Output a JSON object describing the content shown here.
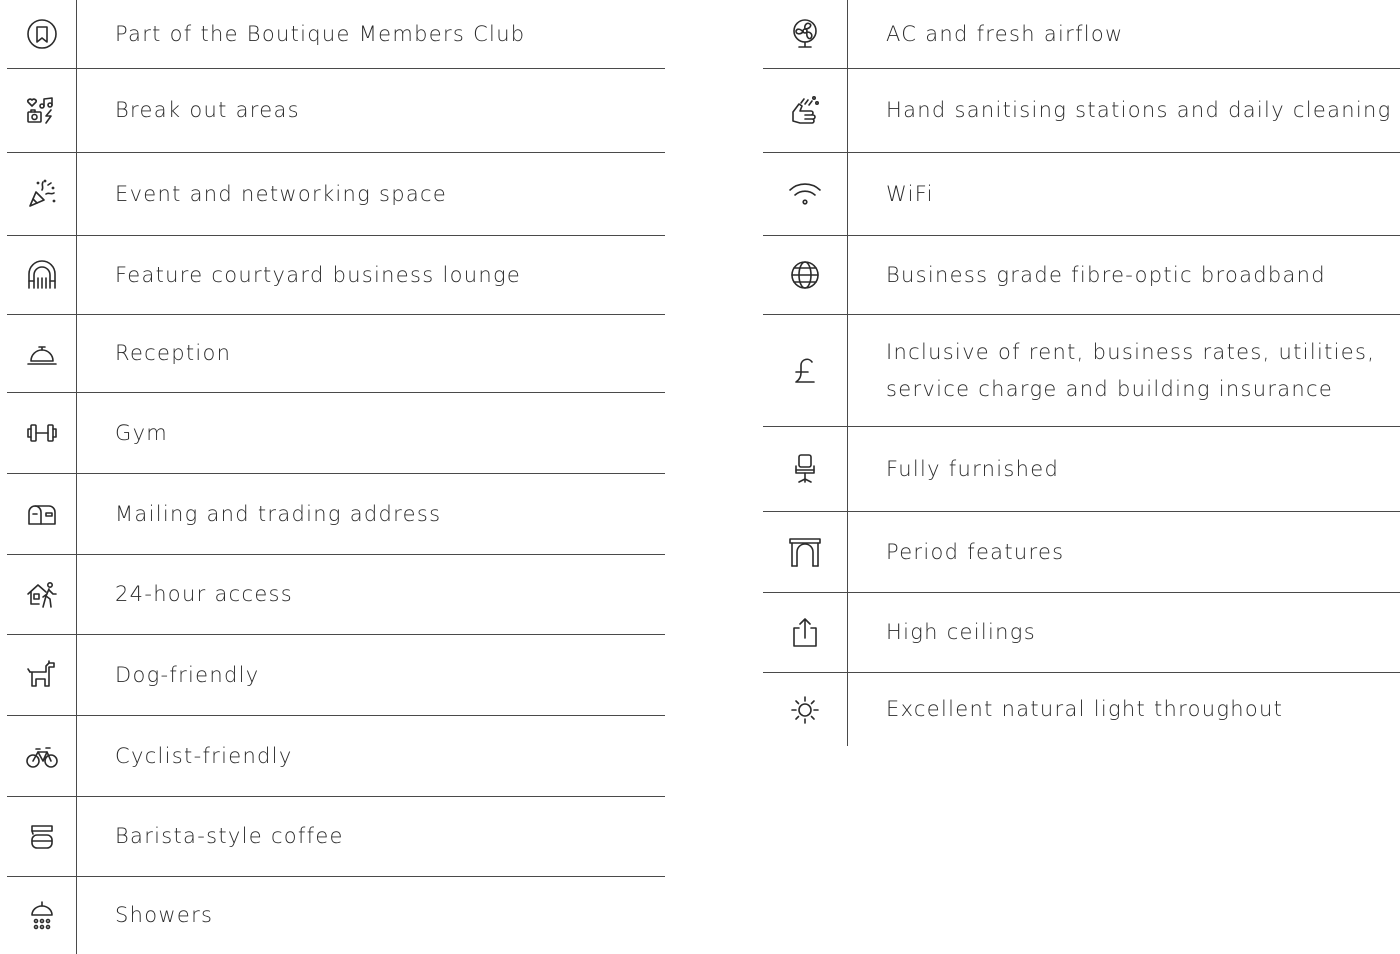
{
  "left_features": [
    {
      "icon": "members-club-icon",
      "label": "Part of the Boutique Members Club"
    },
    {
      "icon": "breakout-areas-icon",
      "label": "Break out areas"
    },
    {
      "icon": "party-popper-icon",
      "label": "Event and networking space"
    },
    {
      "icon": "courtyard-arch-icon",
      "label": "Feature courtyard business lounge"
    },
    {
      "icon": "reception-bell-icon",
      "label": "Reception"
    },
    {
      "icon": "dumbbell-icon",
      "label": "Gym"
    },
    {
      "icon": "mailbox-icon",
      "label": "Mailing and trading address"
    },
    {
      "icon": "house-walking-person-icon",
      "label": "24-hour access"
    },
    {
      "icon": "dog-icon",
      "label": "Dog-friendly"
    },
    {
      "icon": "bicycle-icon",
      "label": "Cyclist-friendly"
    },
    {
      "icon": "coffee-machine-icon",
      "label": "Barista-style coffee"
    },
    {
      "icon": "shower-icon",
      "label": "Showers"
    }
  ],
  "right_features": [
    {
      "icon": "fan-icon",
      "label": "AC and fresh airflow"
    },
    {
      "icon": "hand-wash-icon",
      "label": "Hand sanitising stations and daily cleaning"
    },
    {
      "icon": "wifi-icon",
      "label": "WiFi"
    },
    {
      "icon": "globe-icon",
      "label": "Business grade fibre-optic broadband"
    },
    {
      "icon": "pound-icon",
      "label_lines": [
        "Inclusive of rent, business rates, utilities,",
        "service charge and building insurance"
      ]
    },
    {
      "icon": "office-chair-icon",
      "label": "Fully furnished"
    },
    {
      "icon": "fireplace-icon",
      "label": "Period features"
    },
    {
      "icon": "high-ceiling-arrow-icon",
      "label": "High ceilings"
    },
    {
      "icon": "sun-icon",
      "label": "Excellent natural light throughout"
    }
  ]
}
